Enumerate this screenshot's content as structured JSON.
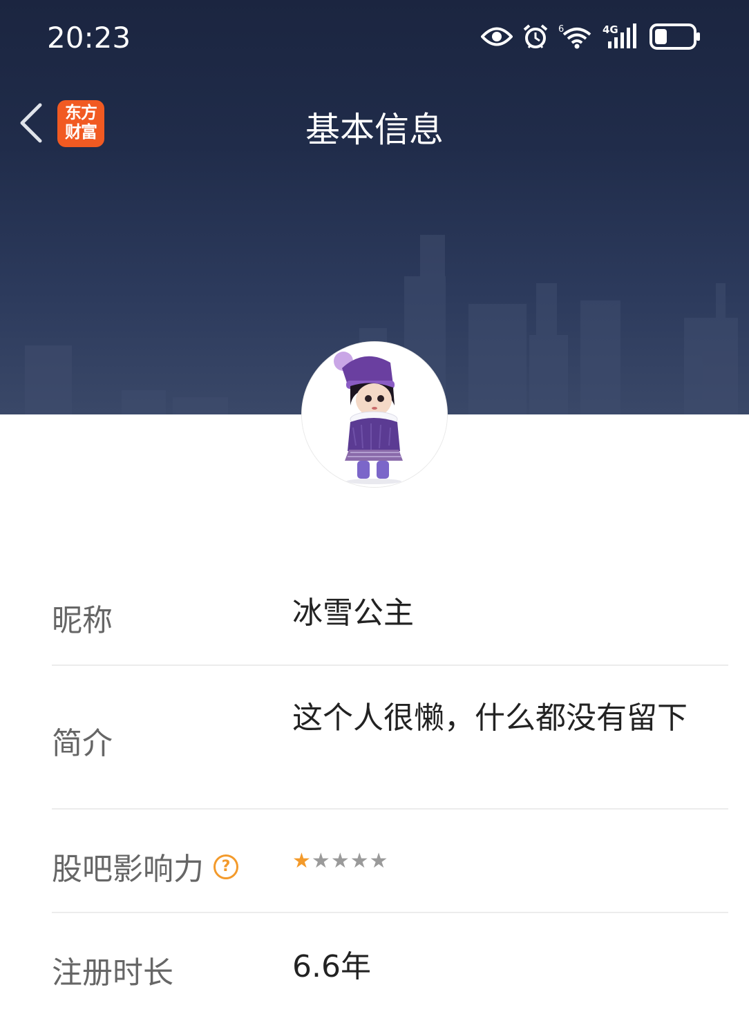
{
  "status_bar": {
    "time": "20:23",
    "icons": [
      "eye-icon",
      "alarm-icon",
      "wifi-6-icon",
      "signal-4g-icon",
      "battery-icon"
    ],
    "wifi_badge": "6",
    "network_badge": "4G"
  },
  "header": {
    "title": "基本信息",
    "app_logo_line1": "东方",
    "app_logo_line2": "财富",
    "back_icon": "chevron-left-icon",
    "banner_color": "#1f2a47",
    "logo_color": "#f15a22"
  },
  "profile": {
    "avatar": "doll-avatar"
  },
  "info": {
    "nickname_label": "昵称",
    "nickname_value": "冰雪公主",
    "bio_label": "简介",
    "bio_value": "这个人很懒，什么都没有留下",
    "influence_label": "股吧影响力",
    "influence_help": "?",
    "influence_rating": 1,
    "influence_max": 5,
    "tenure_label": "注册时长",
    "tenure_value": "6.6年"
  },
  "colors": {
    "accent": "#f39a2b",
    "label_text": "#666666",
    "value_text": "#222222",
    "divider": "#ececec"
  }
}
